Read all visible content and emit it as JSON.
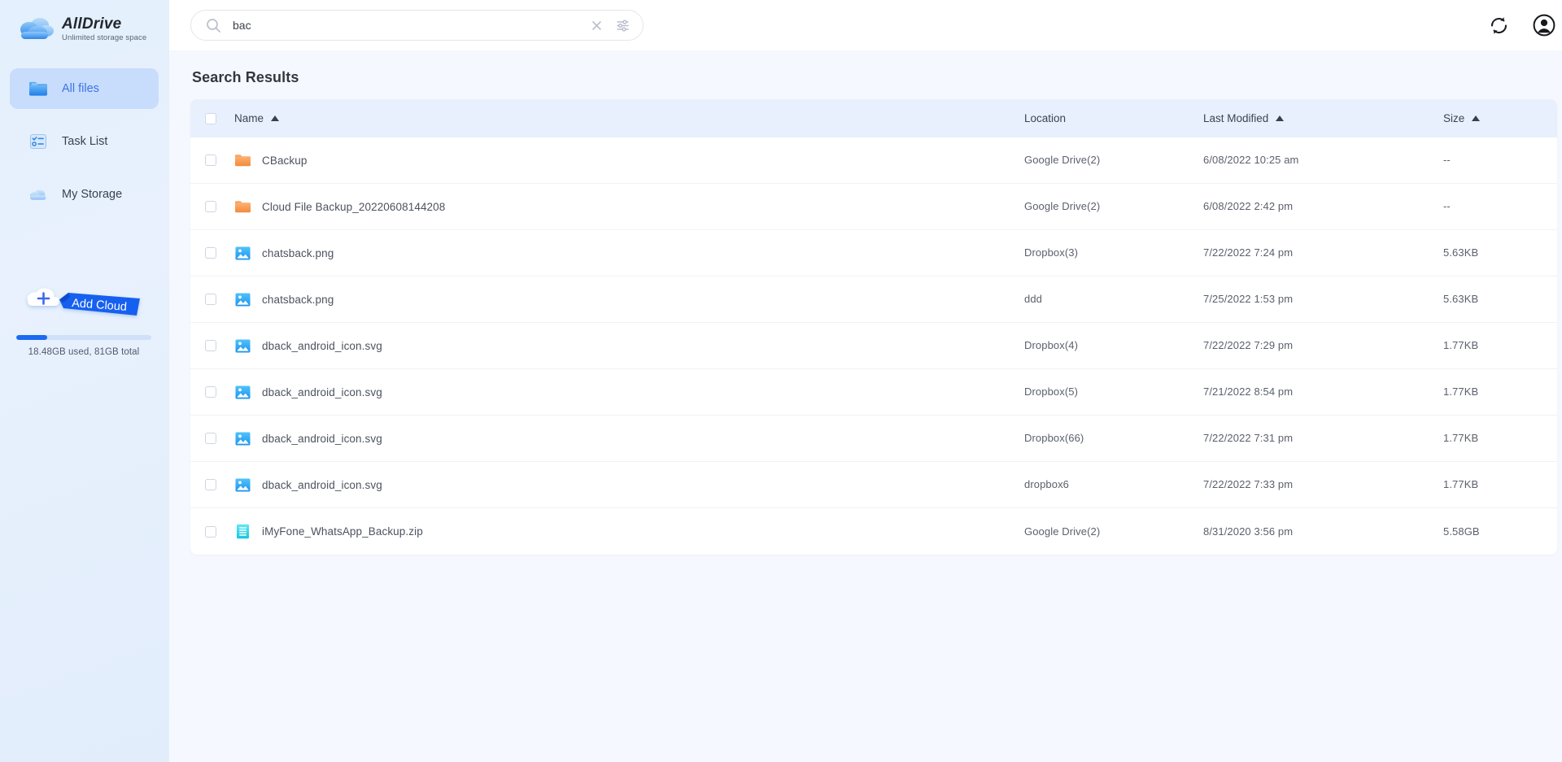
{
  "brand": {
    "name": "AllDrive",
    "tagline": "Unlimited storage space",
    "logo_icon": "cloud-icon"
  },
  "sidebar": {
    "items": [
      {
        "label": "All files",
        "icon": "folder-icon",
        "active": true
      },
      {
        "label": "Task List",
        "icon": "task-list-icon",
        "active": false
      },
      {
        "label": "My Storage",
        "icon": "cloud-storage-icon",
        "active": false
      }
    ],
    "add_cloud": {
      "label": "Add Cloud",
      "icon": "plus-cloud-icon",
      "color": "#1b6af0"
    },
    "storage": {
      "text": "18.48GB used, 81GB total",
      "used_percent": 23,
      "fill_color": "#1b6af0",
      "track_color": "#cfe0f8"
    }
  },
  "topbar": {
    "search": {
      "value": "bac",
      "placeholder": "Search",
      "search_icon": "search-icon",
      "clear_icon": "close-icon",
      "filter_icon": "filter-sliders-icon"
    },
    "refresh_icon": "refresh-sync-icon",
    "account_icon": "account-avatar-icon"
  },
  "main": {
    "title": "Search Results",
    "table": {
      "select_all_checkbox": false,
      "columns": [
        {
          "label": "Name",
          "sortable": true,
          "sort": "asc"
        },
        {
          "label": "Location",
          "sortable": false,
          "sort": "none"
        },
        {
          "label": "Last Modified",
          "sortable": true,
          "sort": "asc"
        },
        {
          "label": "Size",
          "sortable": true,
          "sort": "asc"
        }
      ],
      "rows": [
        {
          "name": "CBackup",
          "icon": "folder-orange-icon",
          "location": "Google Drive(2)",
          "modified": "6/08/2022 10:25 am",
          "size": "--",
          "checked": false
        },
        {
          "name": "Cloud File Backup_20220608144208",
          "icon": "folder-orange-icon",
          "location": "Google Drive(2)",
          "modified": "6/08/2022 2:42 pm",
          "size": "--",
          "checked": false
        },
        {
          "name": "chatsback.png",
          "icon": "image-file-icon",
          "location": "Dropbox(3)",
          "modified": "7/22/2022 7:24 pm",
          "size": "5.63KB",
          "checked": false
        },
        {
          "name": "chatsback.png",
          "icon": "image-file-icon",
          "location": "ddd",
          "modified": "7/25/2022 1:53 pm",
          "size": "5.63KB",
          "checked": false
        },
        {
          "name": "dback_android_icon.svg",
          "icon": "image-file-icon",
          "location": "Dropbox(4)",
          "modified": "7/22/2022 7:29 pm",
          "size": "1.77KB",
          "checked": false
        },
        {
          "name": "dback_android_icon.svg",
          "icon": "image-file-icon",
          "location": "Dropbox(5)",
          "modified": "7/21/2022 8:54 pm",
          "size": "1.77KB",
          "checked": false
        },
        {
          "name": "dback_android_icon.svg",
          "icon": "image-file-icon",
          "location": "Dropbox(66)",
          "modified": "7/22/2022 7:31 pm",
          "size": "1.77KB",
          "checked": false
        },
        {
          "name": "dback_android_icon.svg",
          "icon": "image-file-icon",
          "location": "dropbox6",
          "modified": "7/22/2022 7:33 pm",
          "size": "1.77KB",
          "checked": false
        },
        {
          "name": "iMyFone_WhatsApp_Backup.zip",
          "icon": "archive-file-icon",
          "location": "Google Drive(2)",
          "modified": "8/31/2020 3:56 pm",
          "size": "5.58GB",
          "checked": false
        }
      ]
    }
  },
  "colors": {
    "accent": "#3b73e8",
    "sidebar_bg": "#e6f0fd",
    "content_bg": "#f5f8fe",
    "header_row_bg": "#e8f0fd",
    "folder_orange": "#f5913e",
    "image_blue": "#29a8f5",
    "archive_cyan": "#21d4e8"
  }
}
